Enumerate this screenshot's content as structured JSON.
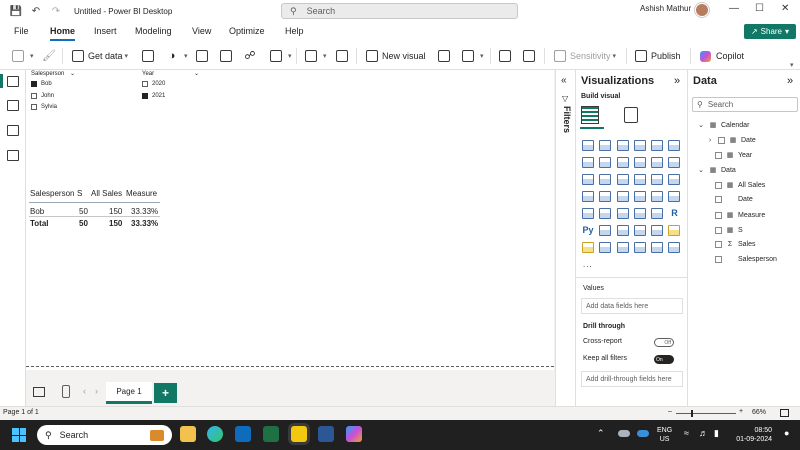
{
  "titlebar": {
    "title": "Untitled - Power BI Desktop",
    "search_placeholder": "Search",
    "user_name": "Ashish Mathur"
  },
  "menu": {
    "tabs": [
      "File",
      "Home",
      "Insert",
      "Modeling",
      "View",
      "Optimize",
      "Help"
    ],
    "active": "Home",
    "share_label": "Share"
  },
  "ribbon": {
    "get_data": "Get data",
    "new_visual": "New visual",
    "sensitivity": "Sensitivity",
    "publish": "Publish",
    "copilot": "Copilot"
  },
  "canvas": {
    "slicer_salesperson": {
      "header": "Salesperson",
      "items": [
        {
          "label": "Bob",
          "checked": true
        },
        {
          "label": "John",
          "checked": false
        },
        {
          "label": "Sylvia",
          "checked": false
        }
      ]
    },
    "slicer_year": {
      "header": "Year",
      "items": [
        {
          "label": "2020",
          "checked": false
        },
        {
          "label": "2021",
          "checked": true
        }
      ]
    },
    "table": {
      "headers": [
        "Salesperson",
        "S",
        "All Sales",
        "Measure"
      ],
      "rows": [
        [
          "Bob",
          "50",
          "150",
          "33.33%"
        ]
      ],
      "total": [
        "Total",
        "50",
        "150",
        "33.33%"
      ]
    }
  },
  "pages": {
    "tabs": [
      "Page 1"
    ],
    "add_label": "+"
  },
  "filters": {
    "label": "Filters"
  },
  "visualizations": {
    "title": "Visualizations",
    "build_visual": "Build visual",
    "values_header": "Values",
    "values_placeholder": "Add data fields here",
    "drill_through": "Drill through",
    "cross_report": "Cross-report",
    "cross_report_state": "Off",
    "keep_all_filters": "Keep all filters",
    "keep_all_filters_state": "On",
    "drill_placeholder": "Add drill-through fields here",
    "more": "..."
  },
  "data_pane": {
    "title": "Data",
    "search_placeholder": "Search",
    "tables": [
      {
        "name": "Calendar",
        "fields": [
          "Date",
          "Year"
        ]
      },
      {
        "name": "Data",
        "fields": [
          "All Sales",
          "Date",
          "Measure",
          "S",
          "Sales",
          "Salesperson"
        ]
      }
    ]
  },
  "status": {
    "page_indicator": "Page 1 of 1",
    "zoom": "66%"
  },
  "taskbar": {
    "search_label": "Search",
    "lang": "ENG",
    "region": "US",
    "time": "08:50",
    "date": "01-09-2024"
  }
}
